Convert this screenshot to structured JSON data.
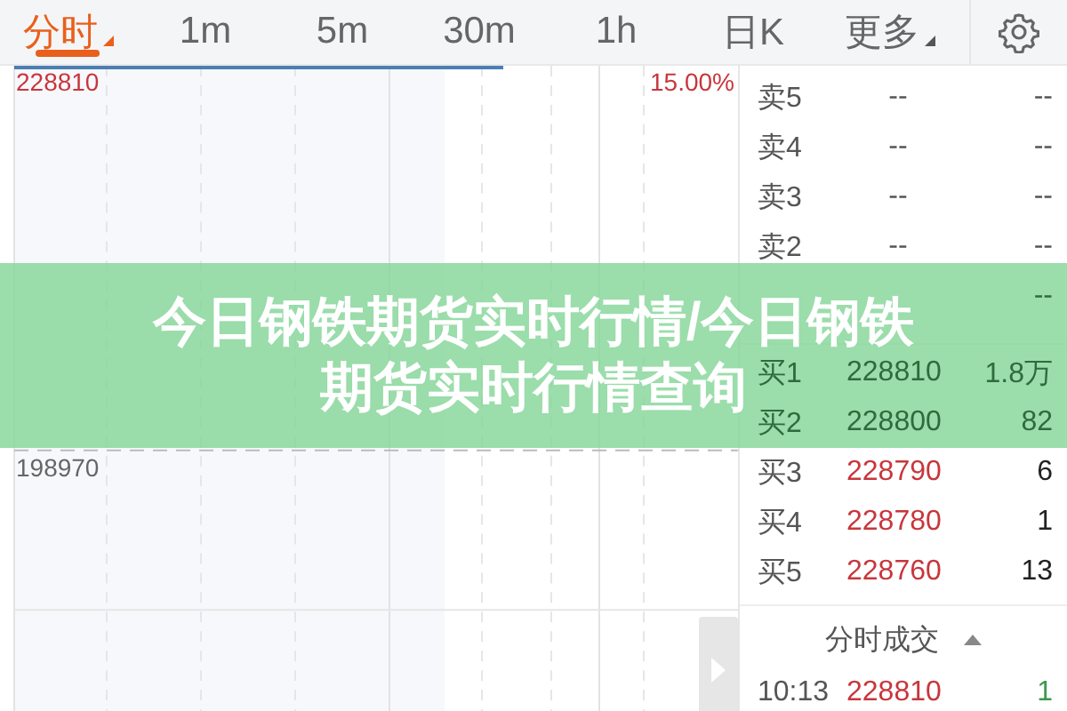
{
  "tabs": [
    {
      "label": "分时",
      "selected": true,
      "has_menu": true
    },
    {
      "label": "1m",
      "selected": false,
      "has_menu": false
    },
    {
      "label": "5m",
      "selected": false,
      "has_menu": false
    },
    {
      "label": "30m",
      "selected": false,
      "has_menu": false
    },
    {
      "label": "1h",
      "selected": false,
      "has_menu": false
    },
    {
      "label": "日K",
      "selected": false,
      "has_menu": false
    },
    {
      "label": "更多",
      "selected": false,
      "has_menu": true
    }
  ],
  "chart": {
    "high_label": "228810",
    "high_pct": "15.00%",
    "low_label": "198970"
  },
  "order_book": [
    {
      "kind": "sell",
      "label": "卖5",
      "price": "--",
      "volume": "--"
    },
    {
      "kind": "sell",
      "label": "卖4",
      "price": "--",
      "volume": "--"
    },
    {
      "kind": "sell",
      "label": "卖3",
      "price": "--",
      "volume": "--"
    },
    {
      "kind": "sell",
      "label": "卖2",
      "price": "--",
      "volume": "--"
    },
    {
      "kind": "sell",
      "volume": "--"
    },
    {
      "kind": "buy",
      "label": "买1",
      "price": "228810",
      "volume": "1.8万"
    },
    {
      "kind": "buy",
      "label": "买2",
      "price": "228800",
      "volume": "82"
    },
    {
      "kind": "buy",
      "label": "买3",
      "price": "228790",
      "volume": "6"
    },
    {
      "kind": "buy",
      "label": "买4",
      "price": "228780",
      "volume": "1"
    },
    {
      "kind": "buy",
      "label": "买5",
      "price": "228760",
      "volume": "13"
    }
  ],
  "trades_header": {
    "title": "分时成交",
    "expanded": false
  },
  "trades": [
    {
      "time": "10:13",
      "price": "228810",
      "volume": "1"
    }
  ],
  "banner": {
    "title_lines": [
      "今日钢铁期货实时行情/今日钢铁",
      "期货实时行情查询"
    ]
  }
}
